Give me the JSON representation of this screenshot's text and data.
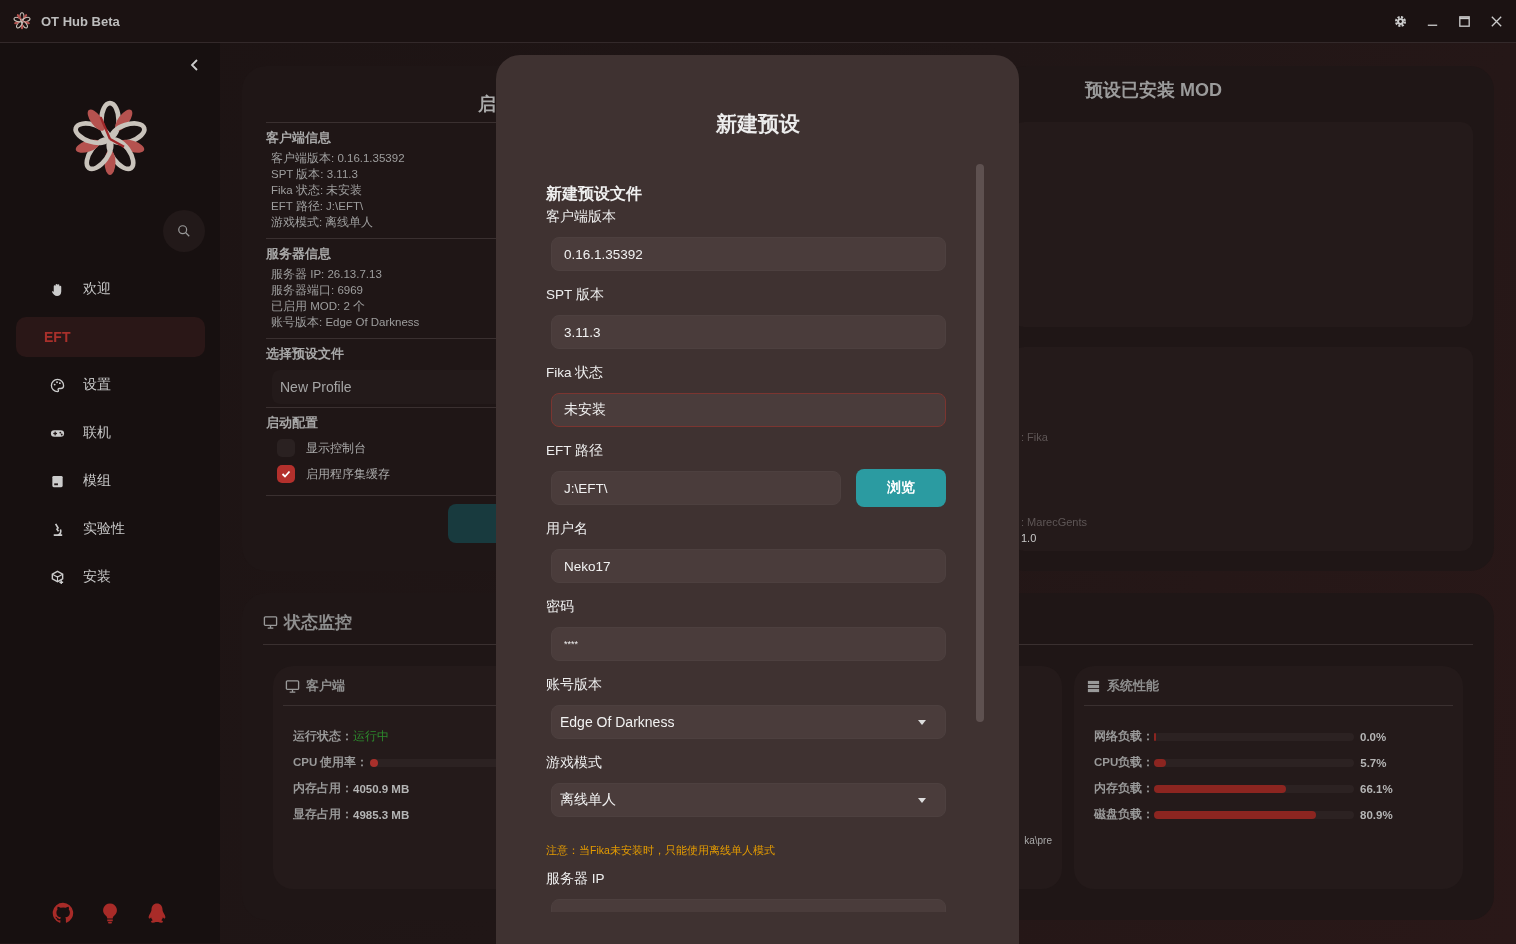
{
  "window": {
    "title": "OT Hub Beta"
  },
  "sidebar": {
    "items": [
      {
        "label": "欢迎",
        "selected": false
      },
      {
        "label": "EFT",
        "selected": true
      },
      {
        "label": "设置",
        "selected": false
      },
      {
        "label": "联机",
        "selected": false
      },
      {
        "label": "模组",
        "selected": false
      },
      {
        "label": "实验性",
        "selected": false
      },
      {
        "label": "安装",
        "selected": false
      }
    ]
  },
  "launch_card": {
    "title_fragment": "启",
    "client_info": {
      "heading": "客户端信息",
      "lines": [
        "客户端版本: 0.16.1.35392",
        "SPT 版本: 3.11.3",
        "Fika 状态: 未安装",
        "EFT 路径: J:\\EFT\\",
        "游戏模式: 离线单人"
      ]
    },
    "server_info": {
      "heading": "服务器信息",
      "lines": [
        "服务器 IP: 26.13.7.13",
        "服务器端口: 6969",
        "已启用 MOD: 2 个",
        "账号版本: Edge Of Darkness"
      ]
    },
    "preset": {
      "label": "选择预设文件",
      "value": "New Profile"
    },
    "launch_config": {
      "heading": "启动配置",
      "options": [
        {
          "label": "显示控制台",
          "checked": false
        },
        {
          "label": "启用程序集缓存",
          "checked": true
        }
      ]
    }
  },
  "installed_mods": {
    "title": "预设已安装 MOD",
    "fragments": [
      ": Fika",
      ": MarecGents",
      "1.0"
    ]
  },
  "status_monitor": {
    "title": "状态监控",
    "client": {
      "title": "客户端",
      "status_label": "运行状态：",
      "status_value": "运行中",
      "cpu": {
        "label": "CPU 使用率：",
        "level": 0.01
      },
      "rows": [
        {
          "label": "内存占用：",
          "value": "4050.9 MB"
        },
        {
          "label": "显存占用：",
          "value": "4985.3 MB"
        }
      ]
    },
    "middle_fragment": "ka\\pre",
    "system": {
      "title": "系统性能",
      "rows": [
        {
          "label": "网络负载：",
          "level": 0.0,
          "reading": "0.0%"
        },
        {
          "label": "CPU负载：",
          "level": 0.057,
          "reading": "5.7%"
        },
        {
          "label": "内存负载：",
          "level": 0.661,
          "reading": "66.1%"
        },
        {
          "label": "磁盘负载：",
          "level": 0.809,
          "reading": "80.9%"
        }
      ]
    }
  },
  "dialog": {
    "title": "新建预设",
    "section": "新建预设文件",
    "fields": [
      {
        "kind": "text",
        "label": "客户端版本",
        "value": "0.16.1.35392",
        "focused": false
      },
      {
        "kind": "text",
        "label": "SPT 版本",
        "value": "3.11.3",
        "focused": false
      },
      {
        "kind": "text",
        "label": "Fika 状态",
        "value": "未安装",
        "focused": true
      },
      {
        "kind": "path",
        "label": "EFT 路径",
        "value": "J:\\EFT\\",
        "button": "浏览",
        "focused": false
      },
      {
        "kind": "text",
        "label": "用户名",
        "value": "Neko17",
        "focused": false
      },
      {
        "kind": "password",
        "label": "密码",
        "value": "****",
        "focused": false
      },
      {
        "kind": "select",
        "label": "账号版本",
        "value": "Edge Of Darkness",
        "focused": false
      },
      {
        "kind": "select",
        "label": "游戏模式",
        "value": "离线单人",
        "focused": false,
        "note": "注意：当Fika未安装时，只能使用离线单人模式"
      },
      {
        "kind": "text",
        "label": "服务器 IP",
        "focused": false
      }
    ]
  }
}
